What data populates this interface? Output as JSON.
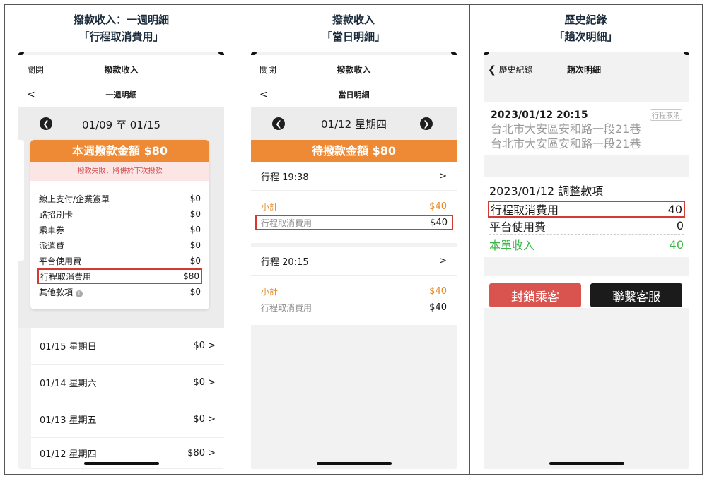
{
  "columns": [
    {
      "line1": "撥款收入：一週明細",
      "line2": "「行程取消費用」"
    },
    {
      "line1": "撥款收入",
      "line2": "「當日明細」"
    },
    {
      "line1": "歷史紀錄",
      "line2": "「趟次明細」"
    }
  ],
  "phone1": {
    "nav_close": "關閉",
    "nav_title": "撥款收入",
    "sub_back": "<",
    "sub_title": "一週明細",
    "prev_icon": "chevron-left-icon",
    "date_range": "01/09 至 01/15",
    "weekly_label": "本週撥款金額 $80",
    "fail_notice": "撥款失敗，將併於下次撥款",
    "items": [
      {
        "label": "線上支付/企業簽單",
        "value": "$0"
      },
      {
        "label": "路招刷卡",
        "value": "$0"
      },
      {
        "label": "乘車券",
        "value": "$0"
      },
      {
        "label": "派遣費",
        "value": "$0"
      },
      {
        "label": "平台使用費",
        "value": "$0"
      },
      {
        "label": "行程取消費用",
        "value": "$80"
      },
      {
        "label": "其他款項",
        "value": "$0"
      }
    ],
    "days": [
      {
        "label": "01/15 星期日",
        "value": "$0 >"
      },
      {
        "label": "01/14 星期六",
        "value": "$0 >"
      },
      {
        "label": "01/13 星期五",
        "value": "$0 >"
      },
      {
        "label": "01/12 星期四",
        "value": "$80 >"
      }
    ]
  },
  "phone2": {
    "nav_close": "關閉",
    "nav_title": "撥款收入",
    "sub_back": "<",
    "sub_title": "當日明細",
    "date": "01/12 星期四",
    "pending_label": "待撥款金額 $80",
    "trips": [
      {
        "title": "行程 19:38",
        "chevron": ">",
        "subtotal_label": "小計",
        "subtotal": "$40",
        "fee_label": "行程取消費用",
        "fee": "$40"
      },
      {
        "title": "行程 20:15",
        "chevron": ">",
        "subtotal_label": "小計",
        "subtotal": "$40",
        "fee_label": "行程取消費用",
        "fee": "$40"
      }
    ]
  },
  "phone3": {
    "back_label": "歷史紀錄",
    "nav_title": "趟次明細",
    "trip_datetime": "2023/01/12 20:15",
    "badge": "行程取消",
    "address_line1": "台北市大安區安和路一段21巷",
    "address_line2": "台北市大安區安和路一段21巷",
    "adjust_title": "2023/01/12 調整款項",
    "lines": [
      {
        "label": "行程取消費用",
        "value": "40"
      },
      {
        "label": "平台使用費",
        "value": "0"
      },
      {
        "label": "本單收入",
        "value": "40"
      }
    ],
    "block_button": "封鎖乘客",
    "contact_button": "聯繫客服",
    "colors": {
      "block": "#d9534f",
      "contact": "#1b1b1b",
      "income": "#3db34a"
    }
  }
}
